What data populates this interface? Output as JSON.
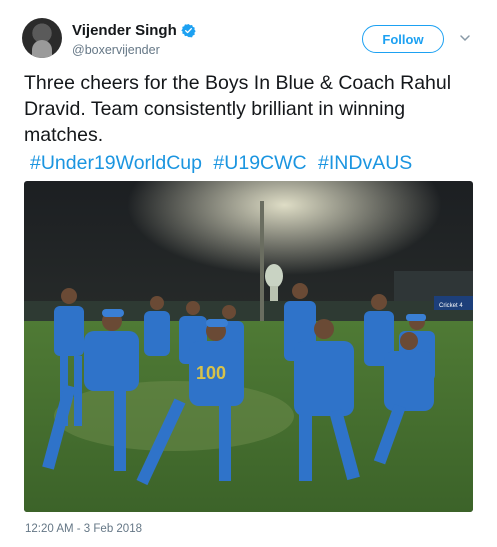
{
  "author": {
    "display_name": "Vijender Singh",
    "handle": "@boxervijender",
    "verified": true,
    "avatar_icon": "avatar-photo"
  },
  "follow_label": "Follow",
  "caret_icon": "chevron-down-icon",
  "tweet": {
    "text": "Three cheers for the Boys In Blue & Coach Rahul Dravid. Team consistently brilliant in winning matches.",
    "hashtags": [
      "#Under19WorldCup",
      "#U19CWC",
      "#INDvAUS"
    ]
  },
  "photo": {
    "description_icon": "team-celebration-photo",
    "jersey_number": "100",
    "board_text": "Cricket 4"
  },
  "timestamp": "12:20 AM - 3 Feb 2018",
  "colors": {
    "link": "#1b95e0",
    "follow": "#1da1f2",
    "muted": "#657786"
  }
}
